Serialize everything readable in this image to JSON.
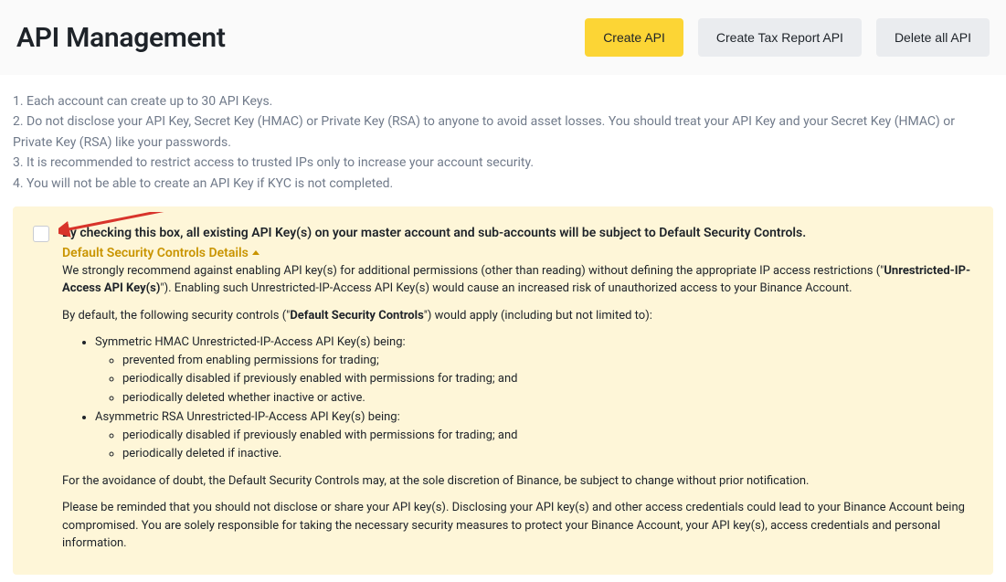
{
  "header": {
    "title": "API Management",
    "buttons": {
      "create": "Create API",
      "tax": "Create Tax Report API",
      "delete": "Delete all API"
    }
  },
  "notes": {
    "n1": "1. Each account can create up to 30 API Keys.",
    "n2": "2. Do not disclose your API Key, Secret Key (HMAC) or Private Key (RSA) to anyone to avoid asset losses. You should treat your API Key and your Secret Key (HMAC) or Private Key (RSA) like your passwords.",
    "n3": "3. It is recommended to restrict access to trusted IPs only to increase your account security.",
    "n4": "4. You will not be able to create an API Key if KYC is not completed."
  },
  "box": {
    "checkbox_label": "By checking this box, all existing API Key(s) on your master account and sub-accounts will be subject to Default Security Controls.",
    "details_link": "Default Security Controls Details",
    "p1a": "We strongly recommend against enabling API key(s) for additional permissions (other than reading) without defining the appropriate IP access restrictions (\"",
    "p1b": "Unrestricted-IP-Access API Key(s)",
    "p1c": "\"). Enabling such Unrestricted-IP-Access API Key(s) would cause an increased risk of unauthorized access to your Binance Account.",
    "p2a": "By default, the following security controls (\"",
    "p2b": "Default Security Controls",
    "p2c": "\") would apply (including but not limited to):",
    "li1": "Symmetric HMAC Unrestricted-IP-Access API Key(s) being:",
    "li1a": "prevented from enabling permissions for trading;",
    "li1b": "periodically disabled if previously enabled with permissions for trading; and",
    "li1c": "periodically deleted whether inactive or active.",
    "li2": "Asymmetric RSA Unrestricted-IP-Access API Key(s) being:",
    "li2a": "periodically disabled if previously enabled with permissions for trading; and",
    "li2b": "periodically deleted if inactive.",
    "p3": "For the avoidance of doubt, the Default Security Controls may, at the sole discretion of Binance, be subject to change without prior notification.",
    "p4": "Please be reminded that you should not disclose or share your API key(s). Disclosing your API key(s) and other access credentials could lead to your Binance Account being compromised. You are solely responsible for taking the necessary security measures to protect your Binance Account, your API key(s), access credentials and personal information."
  }
}
